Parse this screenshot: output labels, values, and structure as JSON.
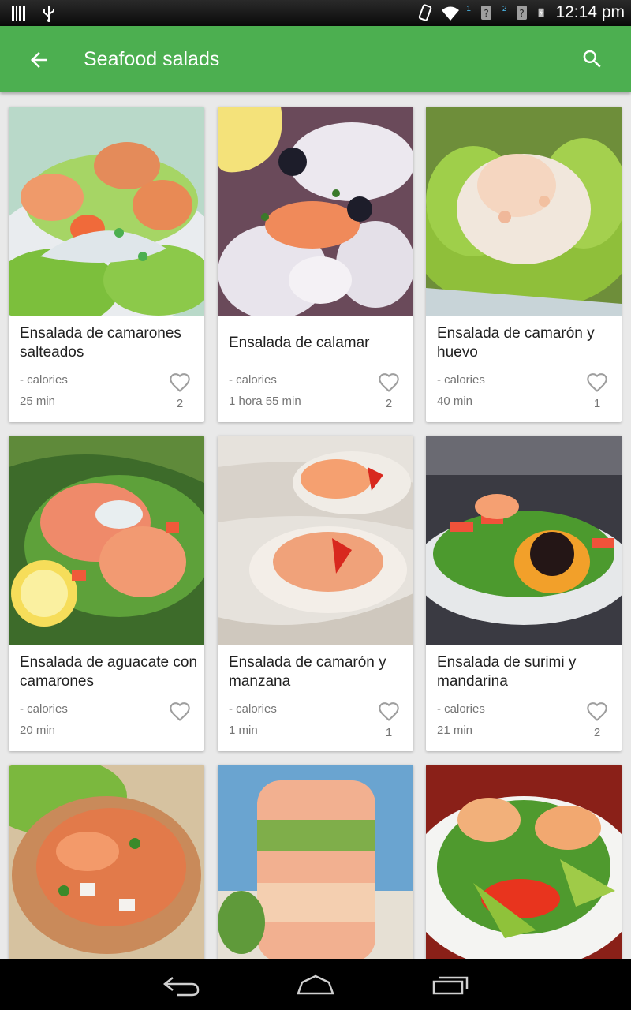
{
  "status_bar": {
    "time": "12:14 pm",
    "sim1": "1",
    "sim2": "2"
  },
  "app_bar": {
    "title": "Seafood salads",
    "back_icon": "arrow-back-icon",
    "search_icon": "search-icon",
    "color": "#4caf50"
  },
  "recipes": [
    {
      "name": "Ensalada de camarones salteados",
      "calories": "- calories",
      "time": "25 min",
      "likes": "2"
    },
    {
      "name": "Ensalada de calamar",
      "calories": "- calories",
      "time": "1 hora 55 min",
      "likes": "2"
    },
    {
      "name": "Ensalada de camarón y huevo",
      "calories": "- calories",
      "time": "40 min",
      "likes": "1"
    },
    {
      "name": "Ensalada de aguacate con camarones",
      "calories": "- calories",
      "time": "20 min",
      "likes": ""
    },
    {
      "name": "Ensalada de camarón y manzana",
      "calories": "- calories",
      "time": "1 min",
      "likes": "1"
    },
    {
      "name": "Ensalada de surimi y mandarina",
      "calories": "- calories",
      "time": "21 min",
      "likes": "2"
    }
  ]
}
